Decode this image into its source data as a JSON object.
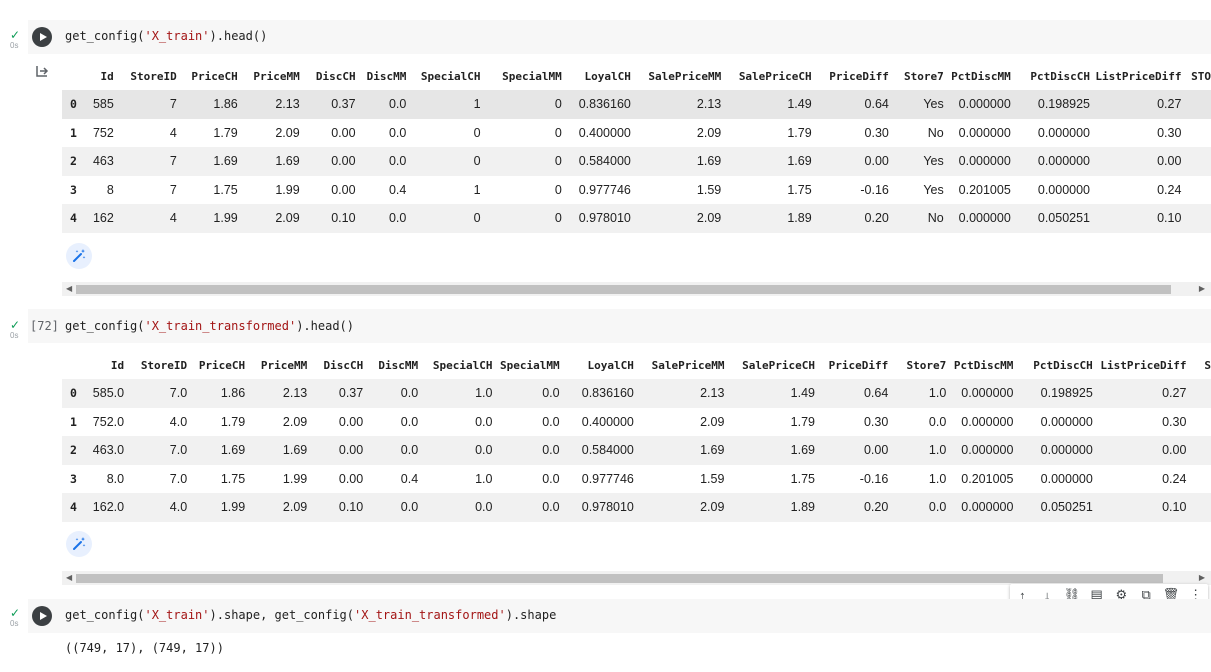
{
  "cells": [
    {
      "code_prefix": "get_config(",
      "code_string": "'X_train'",
      "code_suffix": ").head()",
      "status_check": "✓",
      "status_time": "0s",
      "output_icon": "output-arrow-icon",
      "table": {
        "columns": [
          "",
          "Id",
          "StoreID",
          "PriceCH",
          "PriceMM",
          "DiscCH",
          "DiscMM",
          "SpecialCH",
          "SpecialMM",
          "LoyalCH",
          "SalePriceMM",
          "SalePriceCH",
          "PriceDiff",
          "Store7",
          "PctDiscMM",
          "PctDiscCH",
          "ListPriceDiff",
          "STO"
        ],
        "rows": [
          [
            "0",
            "585",
            "7",
            "1.86",
            "2.13",
            "0.37",
            "0.0",
            "1",
            "0",
            "0.836160",
            "2.13",
            "1.49",
            "0.64",
            "Yes",
            "0.000000",
            "0.198925",
            "0.27",
            ""
          ],
          [
            "1",
            "752",
            "4",
            "1.79",
            "2.09",
            "0.00",
            "0.0",
            "0",
            "0",
            "0.400000",
            "2.09",
            "1.79",
            "0.30",
            "No",
            "0.000000",
            "0.000000",
            "0.30",
            ""
          ],
          [
            "2",
            "463",
            "7",
            "1.69",
            "1.69",
            "0.00",
            "0.0",
            "0",
            "0",
            "0.584000",
            "1.69",
            "1.69",
            "0.00",
            "Yes",
            "0.000000",
            "0.000000",
            "0.00",
            ""
          ],
          [
            "3",
            "8",
            "7",
            "1.75",
            "1.99",
            "0.00",
            "0.4",
            "1",
            "0",
            "0.977746",
            "1.59",
            "1.75",
            "-0.16",
            "Yes",
            "0.201005",
            "0.000000",
            "0.24",
            ""
          ],
          [
            "4",
            "162",
            "4",
            "1.99",
            "2.09",
            "0.10",
            "0.0",
            "0",
            "0",
            "0.978010",
            "2.09",
            "1.89",
            "0.20",
            "No",
            "0.000000",
            "0.050251",
            "0.10",
            ""
          ]
        ]
      }
    },
    {
      "exec_count": "[72]",
      "code_prefix": "get_config(",
      "code_string": "'X_train_transformed'",
      "code_suffix": ").head()",
      "status_check": "✓",
      "status_time": "0s",
      "table": {
        "columns": [
          "",
          "Id",
          "StoreID",
          "PriceCH",
          "PriceMM",
          "DiscCH",
          "DiscMM",
          "SpecialCH",
          "SpecialMM",
          "LoyalCH",
          "SalePriceMM",
          "SalePriceCH",
          "PriceDiff",
          "Store7",
          "PctDiscMM",
          "PctDiscCH",
          "ListPriceDiff",
          "S"
        ],
        "rows": [
          [
            "0",
            "585.0",
            "7.0",
            "1.86",
            "2.13",
            "0.37",
            "0.0",
            "1.0",
            "0.0",
            "0.836160",
            "2.13",
            "1.49",
            "0.64",
            "1.0",
            "0.000000",
            "0.198925",
            "0.27",
            ""
          ],
          [
            "1",
            "752.0",
            "4.0",
            "1.79",
            "2.09",
            "0.00",
            "0.0",
            "0.0",
            "0.0",
            "0.400000",
            "2.09",
            "1.79",
            "0.30",
            "0.0",
            "0.000000",
            "0.000000",
            "0.30",
            ""
          ],
          [
            "2",
            "463.0",
            "7.0",
            "1.69",
            "1.69",
            "0.00",
            "0.0",
            "0.0",
            "0.0",
            "0.584000",
            "1.69",
            "1.69",
            "0.00",
            "1.0",
            "0.000000",
            "0.000000",
            "0.00",
            ""
          ],
          [
            "3",
            "8.0",
            "7.0",
            "1.75",
            "1.99",
            "0.00",
            "0.4",
            "1.0",
            "0.0",
            "0.977746",
            "1.59",
            "1.75",
            "-0.16",
            "1.0",
            "0.201005",
            "0.000000",
            "0.24",
            ""
          ],
          [
            "4",
            "162.0",
            "4.0",
            "1.99",
            "2.09",
            "0.10",
            "0.0",
            "0.0",
            "0.0",
            "0.978010",
            "2.09",
            "1.89",
            "0.20",
            "0.0",
            "0.000000",
            "0.050251",
            "0.10",
            ""
          ]
        ]
      }
    },
    {
      "code_p1": "get_config(",
      "code_s1": "'X_train'",
      "code_p2": ").shape, get_config(",
      "code_s2": "'X_train_transformed'",
      "code_p3": ").shape",
      "status_check": "✓",
      "status_time": "0s",
      "output": "((749, 17), (749, 17))"
    }
  ],
  "toolbar_icons": [
    "arrow-up-icon",
    "arrow-down-icon",
    "link-icon",
    "comment-icon",
    "gear-icon",
    "mirror-cell-icon",
    "delete-icon",
    "more-vert-icon"
  ],
  "colors": {
    "string": "#a31515",
    "check": "#0f9d58",
    "cell_bg": "#f7f7f7",
    "wand_bg": "#e8f0fe",
    "wand_icon": "#1a73e8"
  }
}
